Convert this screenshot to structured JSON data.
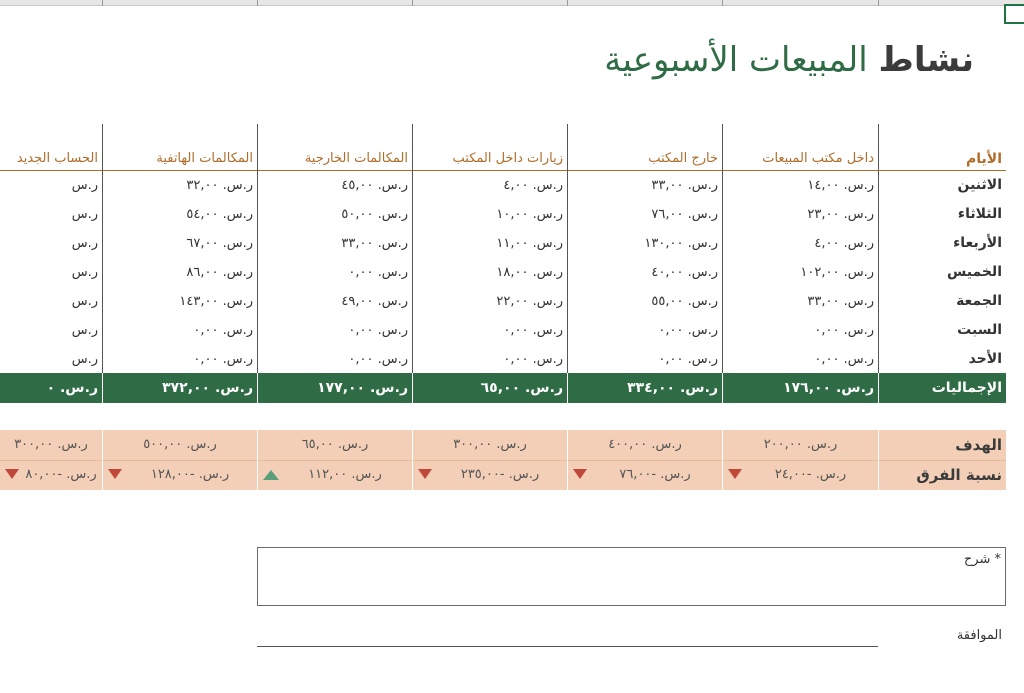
{
  "title": {
    "bold": "نشاط",
    "rest": " المبيعات الأسبوعية"
  },
  "headers": [
    "الأيام",
    "داخل مكتب المبيعات",
    "خارج المكتب",
    "زيارات داخل المكتب",
    "المكالمات الخارجية",
    "المكالمات الهاتفية",
    "الحساب الجديد"
  ],
  "rows": [
    {
      "day": "الاثنين",
      "cells": [
        "ر.س. ١٤,٠٠",
        "ر.س. ٣٣,٠٠",
        "ر.س. ٤,٠٠",
        "ر.س. ٤٥,٠٠",
        "ر.س. ٣٢,٠٠",
        "ر.س"
      ]
    },
    {
      "day": "الثلاثاء",
      "cells": [
        "ر.س. ٢٣,٠٠",
        "ر.س. ٧٦,٠٠",
        "ر.س. ١٠,٠٠",
        "ر.س. ٥٠,٠٠",
        "ر.س. ٥٤,٠٠",
        "ر.س"
      ]
    },
    {
      "day": "الأربعاء",
      "cells": [
        "ر.س. ٤,٠٠",
        "ر.س. ١٣٠,٠٠",
        "ر.س. ١١,٠٠",
        "ر.س. ٣٣,٠٠",
        "ر.س. ٦٧,٠٠",
        "ر.س"
      ]
    },
    {
      "day": "الخميس",
      "cells": [
        "ر.س. ١٠٢,٠٠",
        "ر.س. ٤٠,٠٠",
        "ر.س. ١٨,٠٠",
        "ر.س. ٠,٠٠",
        "ر.س. ٨٦,٠٠",
        "ر.س"
      ]
    },
    {
      "day": "الجمعة",
      "cells": [
        "ر.س. ٣٣,٠٠",
        "ر.س. ٥٥,٠٠",
        "ر.س. ٢٢,٠٠",
        "ر.س. ٤٩,٠٠",
        "ر.س. ١٤٣,٠٠",
        "ر.س"
      ]
    },
    {
      "day": "السبت",
      "cells": [
        "ر.س. ٠,٠٠",
        "ر.س. ٠,٠٠",
        "ر.س. ٠,٠٠",
        "ر.س. ٠,٠٠",
        "ر.س. ٠,٠٠",
        "ر.س"
      ]
    },
    {
      "day": "الأحد",
      "cells": [
        "ر.س. ٠,٠٠",
        "ر.س. ٠,٠٠",
        "ر.س. ٠,٠٠",
        "ر.س. ٠,٠٠",
        "ر.س. ٠,٠٠",
        "ر.س"
      ]
    }
  ],
  "totals": {
    "label": "الإجماليات",
    "cells": [
      "ر.س. ١٧٦,٠٠",
      "ر.س. ٣٣٤,٠٠",
      "ر.س. ٦٥,٠٠",
      "ر.س. ١٧٧,٠٠",
      "ر.س. ٣٧٢,٠٠",
      "ر.س. ٠"
    ]
  },
  "goal": {
    "label": "الهدف",
    "cells": [
      "ر.س. ٢٠٠,٠٠",
      "ر.س. ٤٠٠,٠٠",
      "ر.س. ٣٠٠,٠٠",
      "ر.س. ٦٥,٠٠",
      "ر.س. ٥٠٠,٠٠",
      "ر.س. ٣٠٠,٠٠"
    ]
  },
  "variance": {
    "label": "نسبة الفرق",
    "cells": [
      "ر.س. -٢٤,٠٠",
      "ر.س. -٧٦,٠٠",
      "ر.س. -٢٣٥,٠٠",
      "ر.س. ١١٢,٠٠",
      "ر.س. -١٢٨,٠٠",
      "ر.س. -٨٠,٠٠"
    ],
    "trend": [
      "down",
      "down",
      "down",
      "up",
      "down",
      "down"
    ]
  },
  "comment_label": "* شرح",
  "approval_label": "الموافقة",
  "colors": {
    "green": "#2f6b45",
    "orange": "#b06d2a",
    "peach": "#f2cfb6",
    "down": "#c0483b",
    "up": "#5a9e7c"
  },
  "icons": {
    "trend_down": "triangle-down-icon",
    "trend_up": "triangle-up-icon"
  }
}
